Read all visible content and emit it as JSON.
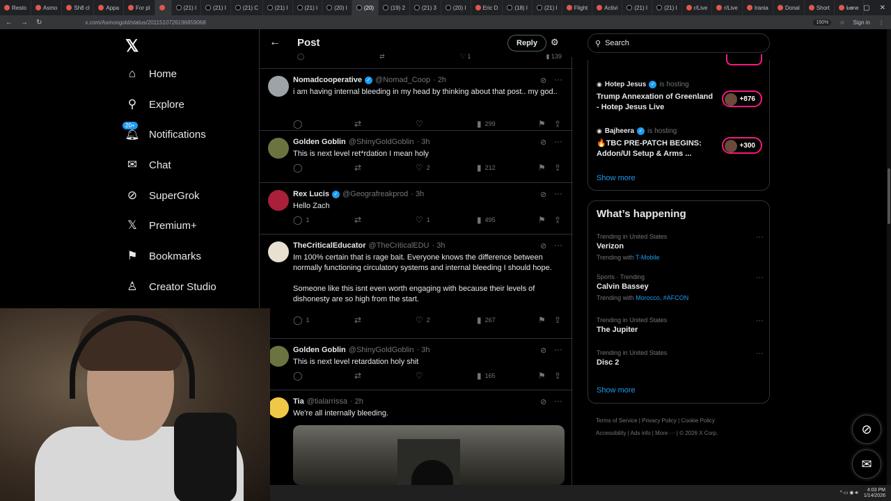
{
  "browser": {
    "tabs": [
      "Resto",
      "Asmo",
      "Sh8 cl",
      "Appa",
      "For pl",
      "",
      "(21) I",
      "(21) I",
      "(21) C",
      "(21) I",
      "(21) I",
      "(20) I",
      "(20)",
      "(19) 2",
      "(21) 3",
      "(20) I",
      "Eric D",
      "(18) I",
      "(21) I",
      "Flight",
      "Activi",
      "(21) I",
      "(21) I",
      "r/Live",
      "r/Live",
      "Irania",
      "Donal",
      "Short",
      "Lone"
    ],
    "url": "x.com/Asmongold/status/2011510726196859068",
    "zoom": "150%",
    "sign_in": "Sign in"
  },
  "sidebar": {
    "items": [
      {
        "label": "Home",
        "icon": "home-icon",
        "glyph": "⌂"
      },
      {
        "label": "Explore",
        "icon": "search-icon",
        "glyph": "⚲"
      },
      {
        "label": "Notifications",
        "icon": "bell-icon",
        "glyph": "🔔︎",
        "badge": "20+"
      },
      {
        "label": "Chat",
        "icon": "mail-icon",
        "glyph": "✉"
      },
      {
        "label": "SuperGrok",
        "icon": "grok-icon",
        "glyph": "⊘"
      },
      {
        "label": "Premium+",
        "icon": "x-icon",
        "glyph": "𝕏"
      },
      {
        "label": "Bookmarks",
        "icon": "bookmark-icon",
        "glyph": "⚑"
      },
      {
        "label": "Creator Studio",
        "icon": "creator-icon",
        "glyph": "♙"
      }
    ]
  },
  "header": {
    "title": "Post",
    "reply": "Reply"
  },
  "prev_tweet_actions": {
    "like": "1",
    "views": "139"
  },
  "tweets": [
    {
      "name": "Nomadcooperative",
      "verified": true,
      "handle": "@Nomad_Coop",
      "time": "· 2h",
      "text": "i am having internal bleeding in my head by thinking about that post.. my god..",
      "replies": "",
      "retweets": "",
      "likes": "",
      "views": "299"
    },
    {
      "name": "Golden Goblin",
      "verified": false,
      "handle": "@ShinyGoldGoblin",
      "time": "· 3h",
      "text": "This is next level ret*rdation I mean holy",
      "replies": "",
      "retweets": "",
      "likes": "2",
      "views": "212"
    },
    {
      "name": "Rex Lucis",
      "verified": true,
      "handle": "@Geografreakprod",
      "time": "· 3h",
      "text": "Hello Zach",
      "replies": "1",
      "retweets": "",
      "likes": "1",
      "views": "495"
    },
    {
      "name": "TheCriticalEducator",
      "verified": false,
      "handle": "@TheCriticalEDU",
      "time": "· 3h",
      "text": "Im 100% certain that is rage bait. Everyone knows the difference between normally functioning circulatory systems and internal bleeding I should hope.",
      "text2": "Someone like this isnt even worth engaging with because their levels of dishonesty are so high from the start.",
      "replies": "1",
      "retweets": "",
      "likes": "2",
      "views": "267"
    },
    {
      "name": "Golden Goblin",
      "verified": false,
      "handle": "@ShinyGoldGoblin",
      "time": "· 3h",
      "text": "This is next level retardation holy shit",
      "replies": "",
      "retweets": "",
      "likes": "",
      "views": "165"
    },
    {
      "name": "Tia",
      "verified": false,
      "handle": "@tialarrissa",
      "time": "· 2h",
      "text": "We're all internally bleeding."
    }
  ],
  "right": {
    "search_placeholder": "Search",
    "live": [
      {
        "host": "Hotep Jesus",
        "verified": true,
        "status": "is hosting",
        "title": "Trump Annexation of Greenland - Hotep Jesus Live",
        "count": "+876"
      },
      {
        "host": "Bajheera",
        "verified": true,
        "status": "is hosting",
        "title": "🔥TBC PRE-PATCH BEGINS: Addon/UI Setup & Arms ...",
        "count": "+300"
      }
    ],
    "show_more": "Show more",
    "whats_happening": "What’s happening",
    "trends": [
      {
        "context": "Trending in United States",
        "name": "Verizon",
        "with_label": "Trending with",
        "with": "T-Mobile"
      },
      {
        "context": "Sports · Trending",
        "name": "Calvin Bassey",
        "with_label": "Trending with",
        "with": "Morocco, #AFCON"
      },
      {
        "context": "Trending in United States",
        "name": "The Jupiter",
        "with_label": "",
        "with": ""
      },
      {
        "context": "Trending in United States",
        "name": "Disc 2",
        "with_label": "",
        "with": ""
      }
    ],
    "show_more_2": "Show more",
    "footer": [
      "Terms of Service",
      "Privacy Policy",
      "Cookie Policy",
      "Accessibility",
      "Ads info",
      "More ···",
      "© 2026 X Corp."
    ]
  },
  "taskbar": {
    "time": "4:03 PM",
    "date": "1/14/2026"
  },
  "colors": {
    "accent": "#1d9bf0",
    "live": "#f91880",
    "border": "#2f3336",
    "muted": "#71767b"
  }
}
